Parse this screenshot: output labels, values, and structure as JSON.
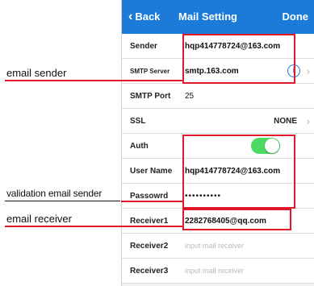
{
  "nav": {
    "back_label": "Back",
    "title": "Mail Setting",
    "done_label": "Done"
  },
  "rows": {
    "sender": {
      "label": "Sender",
      "value": "hqp414778724@163.com"
    },
    "smtp_server": {
      "label": "SMTP Server",
      "value": "smtp.163.com"
    },
    "smtp_port": {
      "label": "SMTP Port",
      "value": "25"
    },
    "ssl": {
      "label": "SSL",
      "value": "NONE"
    },
    "auth": {
      "label": "Auth",
      "enabled": true
    },
    "user_name": {
      "label": "User Name",
      "value": "hqp414778724@163.com"
    },
    "password": {
      "label": "Passowrd",
      "value": "••••••••••"
    },
    "receiver1": {
      "label": "Receiver1",
      "value": "2282768405@qq.com"
    },
    "receiver2": {
      "label": "Receiver2",
      "placeholder": "input mail receiver"
    },
    "receiver3": {
      "label": "Receiver3",
      "placeholder": "input mail receiver"
    }
  },
  "annotations": {
    "email_sender": "email sender",
    "validation_email_sender": "validation email sender",
    "email_receiver": "email receiver"
  },
  "colors": {
    "nav_blue": "#1c7bd9",
    "annotation_red": "#e0192a",
    "toggle_green": "#4cd964"
  }
}
